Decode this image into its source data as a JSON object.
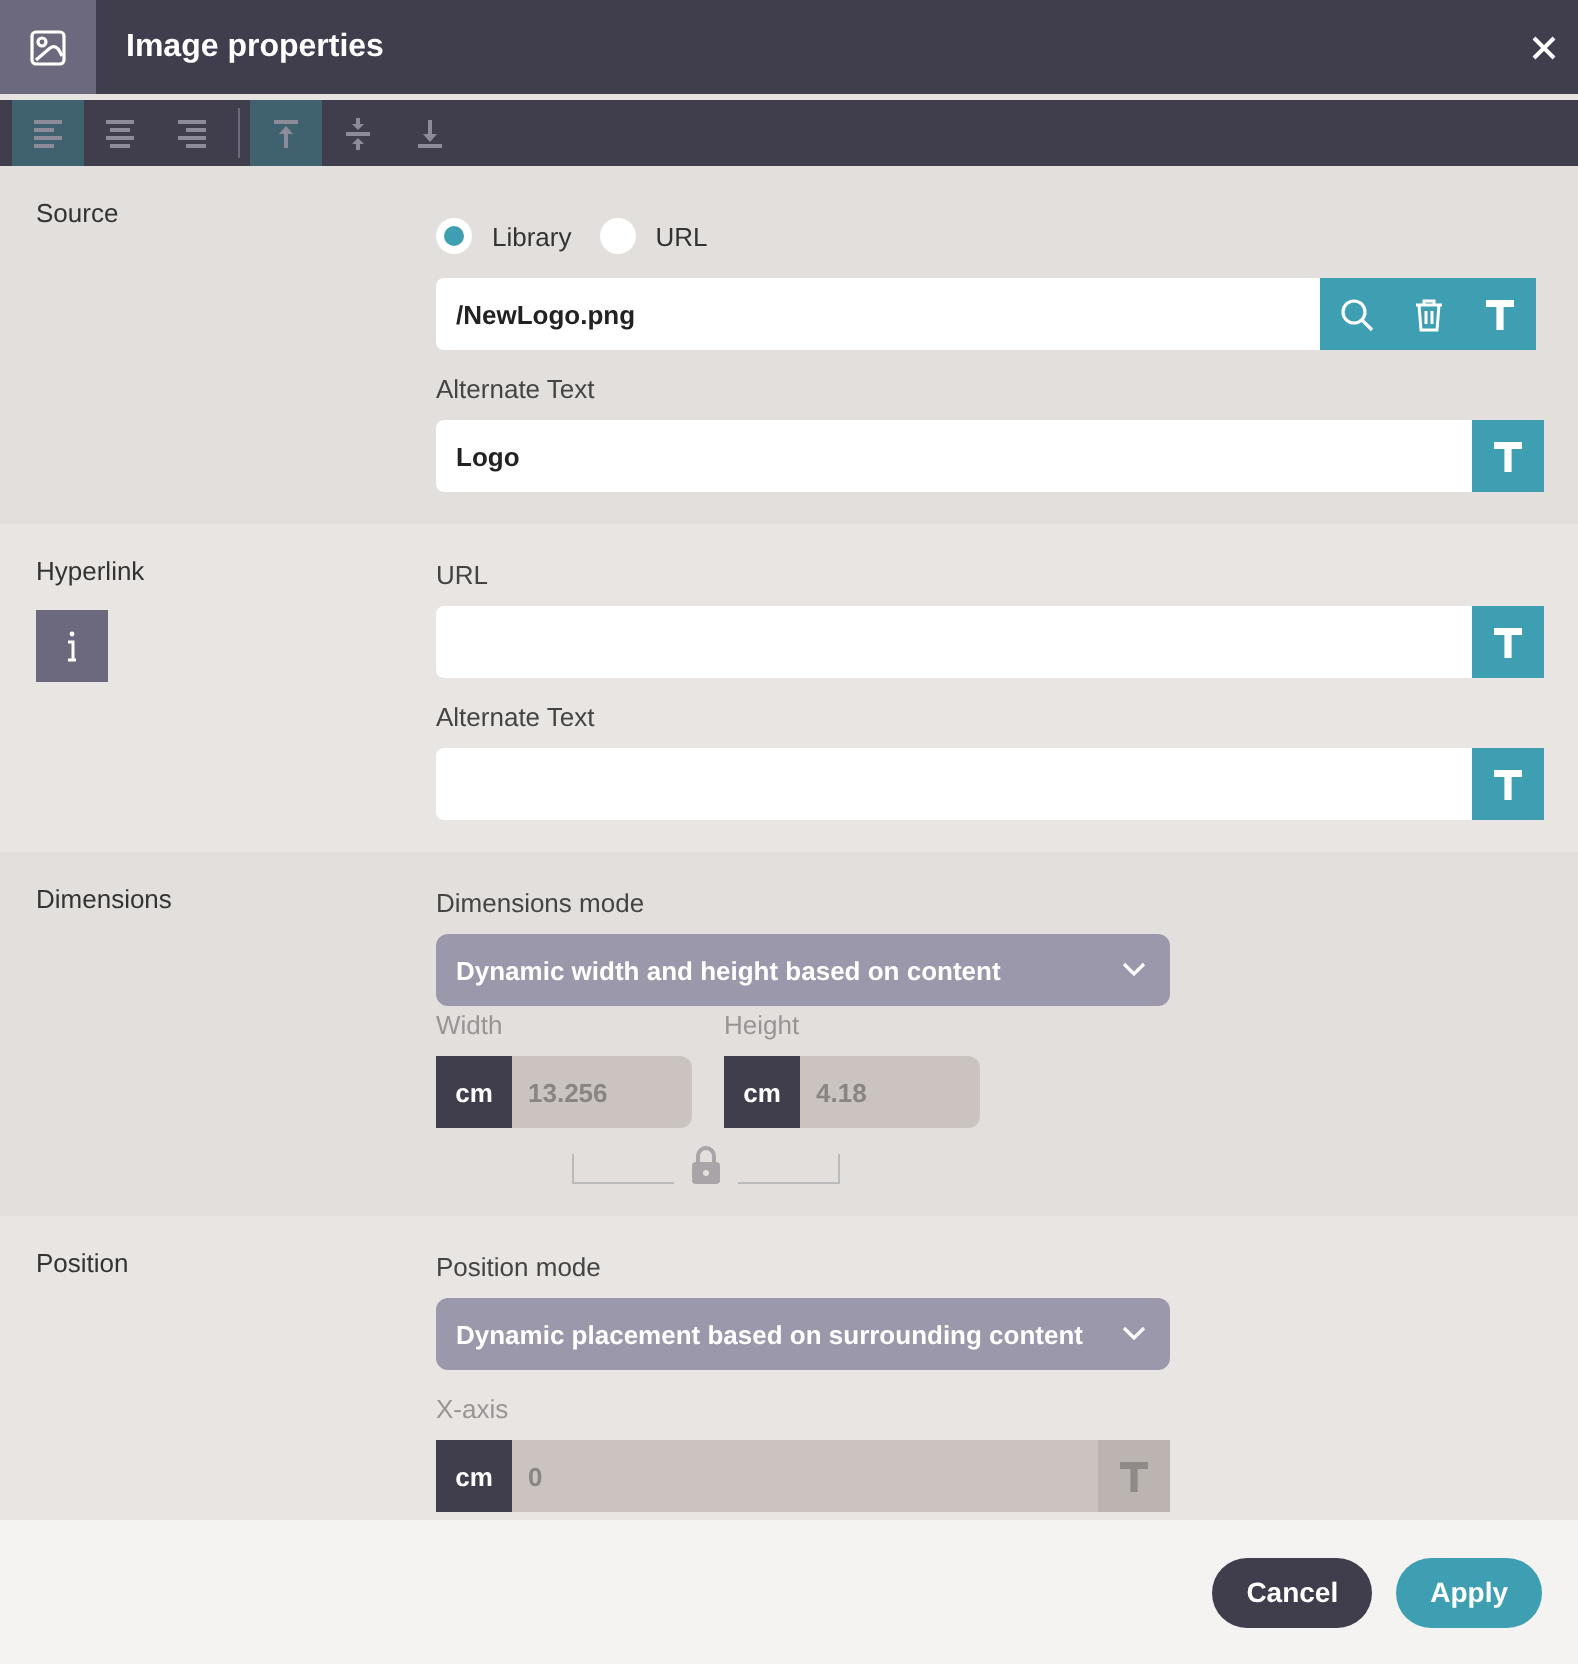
{
  "window": {
    "title": "Image properties"
  },
  "toolbar": [
    [
      {
        "kind": "align-left",
        "selected": true
      },
      {
        "kind": "align-center",
        "selected": false
      },
      {
        "kind": "align-right",
        "selected": false
      }
    ],
    [
      {
        "kind": "valign-top",
        "selected": true
      },
      {
        "kind": "valign-middle",
        "selected": false
      },
      {
        "kind": "valign-bottom",
        "selected": false
      }
    ]
  ],
  "source": {
    "label": "Source",
    "options": [
      {
        "label": "Library",
        "selected": true
      },
      {
        "label": "URL",
        "selected": false
      }
    ],
    "path": {
      "value": "/NewLogo.png",
      "buttons": [
        {
          "kind": "search"
        },
        {
          "kind": "delete"
        },
        {
          "kind": "text"
        }
      ]
    },
    "alt": {
      "label": "Alternate Text",
      "value": "Logo",
      "buttons": [
        {
          "kind": "text"
        }
      ]
    }
  },
  "hyperlink": {
    "label": "Hyperlink",
    "url": {
      "label": "URL",
      "buttons": [
        {
          "kind": "text"
        }
      ]
    },
    "alt": {
      "label": "Alternate Text",
      "buttons": [
        {
          "kind": "text"
        }
      ]
    }
  },
  "dimensions": {
    "label": "Dimensions",
    "mode_label": "Dimensions mode",
    "mode": "Dynamic width and height based on content",
    "width": {
      "label": "Width",
      "unit": "cm",
      "value": "13.256",
      "disabled": true
    },
    "height": {
      "label": "Height",
      "unit": "cm",
      "value": "4.18",
      "disabled": true
    },
    "locked": true
  },
  "position": {
    "label": "Position",
    "mode_label": "Position mode",
    "mode": "Dynamic placement based on surrounding content",
    "x_axis": {
      "label": "X-axis",
      "unit": "cm",
      "value": "0",
      "disabled": true
    }
  },
  "buttons": [
    {
      "label": "Cancel",
      "kind": "secondary"
    },
    {
      "label": "Apply",
      "kind": "primary"
    }
  ]
}
